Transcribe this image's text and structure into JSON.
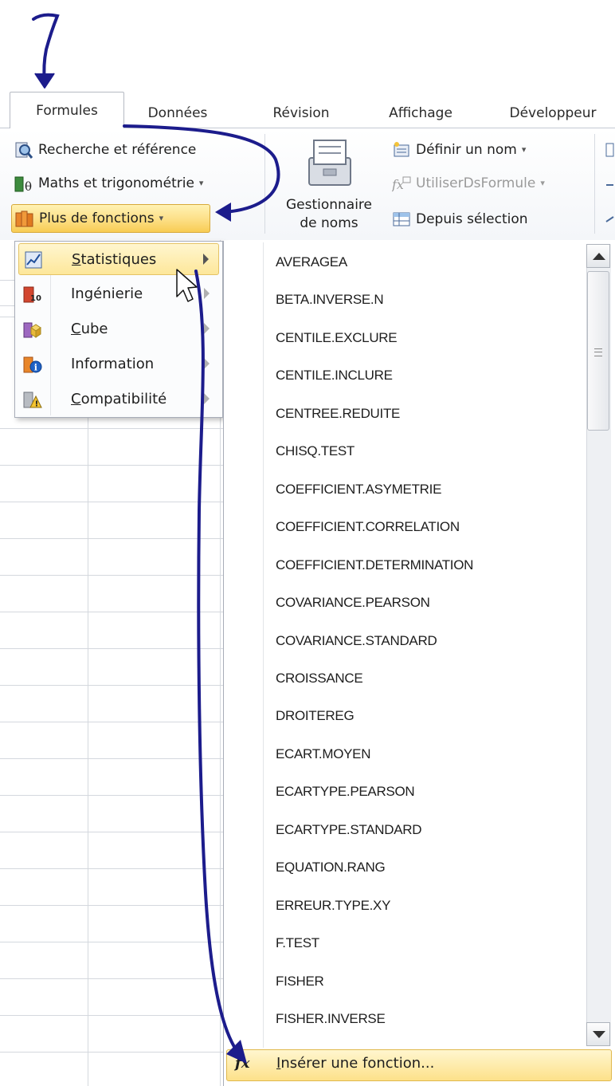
{
  "step_number": "7",
  "tabs": [
    "Formules",
    "Données",
    "Révision",
    "Affichage",
    "Développeur"
  ],
  "active_tab": "Formules",
  "ribbon": {
    "functions": {
      "lookup_label": "Recherche et référence",
      "math_label": "Maths et trigonométrie",
      "more_label": "Plus de fonctions"
    },
    "names": {
      "manager_line1": "Gestionnaire",
      "manager_line2": "de noms",
      "define_label": "Définir un nom",
      "use_label": "UtiliserDsFormule",
      "selection_label": "Depuis sélection"
    },
    "dropdown_glyph": "▾"
  },
  "submenu": {
    "items": [
      {
        "label": "Statistiques",
        "mnemonic": "S",
        "rest": "tatistiques",
        "icon": "statistics-icon",
        "highlighted": true
      },
      {
        "label": "Ingénierie",
        "mnemonic": "",
        "rest": "Ingénierie",
        "icon": "engineering-icon"
      },
      {
        "label": "Cube",
        "mnemonic": "C",
        "rest": "ube",
        "icon": "cube-icon"
      },
      {
        "label": "Information",
        "mnemonic": "",
        "rest": "Information",
        "icon": "information-icon"
      },
      {
        "label": "Compatibilité",
        "mnemonic": "C",
        "rest": "ompatibilité",
        "icon": "compatibility-icon"
      }
    ]
  },
  "function_list": [
    "AVERAGEA",
    "BETA.INVERSE.N",
    "CENTILE.EXCLURE",
    "CENTILE.INCLURE",
    "CENTREE.REDUITE",
    "CHISQ.TEST",
    "COEFFICIENT.ASYMETRIE",
    "COEFFICIENT.CORRELATION",
    "COEFFICIENT.DETERMINATION",
    "COVARIANCE.PEARSON",
    "COVARIANCE.STANDARD",
    "CROISSANCE",
    "DROITEREG",
    "ECART.MOYEN",
    "ECARTYPE.PEARSON",
    "ECARTYPE.STANDARD",
    "EQUATION.RANG",
    "ERREUR.TYPE.XY",
    "F.TEST",
    "FISHER",
    "FISHER.INVERSE"
  ],
  "insert_function": {
    "icon_text": "fx",
    "mnemonic": "I",
    "rest": "nsérer une fonction..."
  },
  "colors": {
    "annotation_arrow": "#1c1c8c",
    "highlight": "#fde79a",
    "ribbon_separator": "#d7dbe2"
  }
}
